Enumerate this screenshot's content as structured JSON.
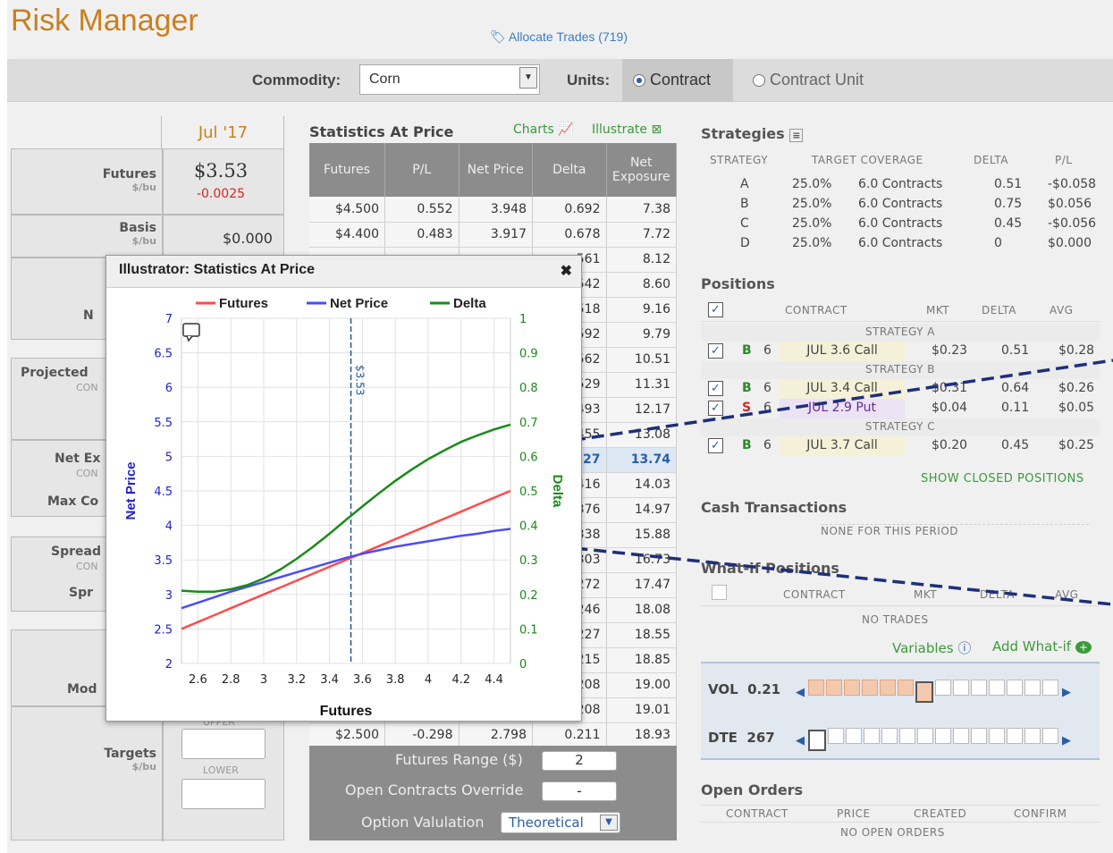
{
  "app": {
    "title": "Risk Manager",
    "allocate": "Allocate Trades (719)"
  },
  "toolbar": {
    "commodity_label": "Commodity:",
    "commodity_value": "Corn",
    "units_label": "Units:",
    "unit_contract": "Contract",
    "unit_contract_unit": "Contract Unit"
  },
  "left": {
    "month": "Jul '17",
    "futures_label": "Futures",
    "futures_unit": "$/bu",
    "futures_value": "$3.53",
    "futures_change": "-0.0025",
    "basis_label": "Basis",
    "basis_unit": "$/bu",
    "basis_value": "$0.000",
    "n_label": "N",
    "projected_label": "Projected",
    "projected_unit": "CON",
    "net_ex_label": "Net Ex",
    "net_ex_unit": "CON",
    "max_label": "Max Co",
    "spread_label": "Spread",
    "spread_unit": "CON",
    "spr_label": "Spr",
    "mod_label": "Mod",
    "upper_label": "UPPER",
    "targets_label": "Targets",
    "targets_unit": "$/bu",
    "lower_label": "LOWER"
  },
  "stats": {
    "title": "Statistics At Price",
    "charts": "Charts",
    "illustrate": "Illustrate",
    "headers": [
      "Futures",
      "P/L",
      "Net Price",
      "Delta",
      "Net Exposure"
    ],
    "rows": [
      [
        "$4.500",
        "0.552",
        "3.948",
        "0.692",
        "7.38"
      ],
      [
        "$4.400",
        "0.483",
        "3.917",
        "0.678",
        "7.72"
      ],
      [
        "",
        "",
        "",
        "561",
        "8.12"
      ],
      [
        "",
        "",
        "",
        "542",
        "8.60"
      ],
      [
        "",
        "",
        "",
        "518",
        "9.16"
      ],
      [
        "",
        "",
        "",
        "592",
        "9.79"
      ],
      [
        "",
        "",
        "",
        "562",
        "10.51"
      ],
      [
        "",
        "",
        "",
        "529",
        "11.31"
      ],
      [
        "",
        "",
        "",
        "493",
        "12.17"
      ],
      [
        "",
        "",
        "",
        "455",
        "13.08"
      ],
      [
        "",
        "",
        "",
        "27",
        "13.74"
      ],
      [
        "",
        "",
        "",
        "416",
        "14.03"
      ],
      [
        "",
        "",
        "",
        "376",
        "14.97"
      ],
      [
        "",
        "",
        "",
        "338",
        "15.88"
      ],
      [
        "",
        "",
        "",
        "303",
        "16.73"
      ],
      [
        "",
        "",
        "",
        "272",
        "17.47"
      ],
      [
        "",
        "",
        "",
        "246",
        "18.08"
      ],
      [
        "",
        "",
        "",
        "227",
        "18.55"
      ],
      [
        "",
        "",
        "",
        "215",
        "18.85"
      ],
      [
        "",
        "",
        "",
        "208",
        "19.00"
      ],
      [
        "",
        "",
        "",
        "208",
        "19.01"
      ],
      [
        "$2.500",
        "-0.298",
        "2.798",
        "0.211",
        "18.93"
      ]
    ],
    "range_label": "Futures Range ($)",
    "range_value": "2",
    "override_label": "Open Contracts Override",
    "override_value": "-",
    "valuation_label": "Option Valulation",
    "valuation_value": "Theoretical"
  },
  "strategies": {
    "title": "Strategies",
    "headers": [
      "STRATEGY",
      "TARGET COVERAGE",
      "DELTA",
      "P/L"
    ],
    "rows": [
      [
        "A",
        "25.0%",
        "6.0 Contracts",
        "0.51",
        "-$0.058"
      ],
      [
        "B",
        "25.0%",
        "6.0 Contracts",
        "0.75",
        "$0.056"
      ],
      [
        "C",
        "25.0%",
        "6.0 Contracts",
        "0.45",
        "-$0.056"
      ],
      [
        "D",
        "25.0%",
        "6.0 Contracts",
        "0",
        "$0.000"
      ]
    ]
  },
  "positions": {
    "title": "Positions",
    "headers": [
      "CONTRACT",
      "MKT",
      "DELTA",
      "AVG"
    ],
    "groups": [
      "STRATEGY A",
      "STRATEGY B",
      "STRATEGY C"
    ],
    "rows": [
      {
        "side": "B",
        "qty": "6",
        "contract": "JUL 3.6 Call",
        "mkt": "$0.23",
        "delta": "0.51",
        "avg": "$0.28"
      },
      {
        "side": "B",
        "qty": "6",
        "contract": "JUL 3.4 Call",
        "mkt": "$0.31",
        "delta": "0.64",
        "avg": "$0.26"
      },
      {
        "side": "S",
        "qty": "6",
        "contract": "JUL 2.9 Put",
        "mkt": "$0.04",
        "delta": "0.11",
        "avg": "$0.05"
      },
      {
        "side": "B",
        "qty": "6",
        "contract": "JUL 3.7 Call",
        "mkt": "$0.20",
        "delta": "0.45",
        "avg": "$0.25"
      }
    ],
    "show_closed": "SHOW CLOSED POSITIONS"
  },
  "cash": {
    "title": "Cash Transactions",
    "none": "NONE FOR THIS PERIOD"
  },
  "whatif": {
    "title": "What-if Positions",
    "headers": [
      "CONTRACT",
      "MKT",
      "DELTA",
      "AVG"
    ],
    "none": "NO TRADES",
    "variables": "Variables",
    "add": "Add What-if",
    "vol_label": "VOL",
    "vol_value": "0.21",
    "dte_label": "DTE",
    "dte_value": "267"
  },
  "orders": {
    "title": "Open Orders",
    "headers": [
      "CONTRACT",
      "PRICE",
      "CREATED",
      "CONFIRM"
    ],
    "none": "NO OPEN ORDERS"
  },
  "popup": {
    "title": "Illustrator: Statistics At Price",
    "close": "✖",
    "marker": "$3.53"
  },
  "colors": {
    "futures": "#ff4b4b",
    "net_price": "#4b4bff",
    "delta": "#1a8a1a"
  },
  "chart_data": {
    "type": "line",
    "title": "",
    "xlabel": "Futures",
    "ylabel": "Net Price",
    "y2label": "Delta",
    "xlim": [
      2.5,
      4.5
    ],
    "ylim": [
      2,
      7
    ],
    "y2lim": [
      0,
      1
    ],
    "xticks": [
      "2.6",
      "2.8",
      "3",
      "3.2",
      "3.4",
      "3.6",
      "3.8",
      "4",
      "4.2",
      "4.4"
    ],
    "yticks": [
      "2",
      "2.5",
      "3",
      "3.5",
      "4",
      "4.5",
      "5",
      "5.5",
      "6",
      "6.5",
      "7"
    ],
    "y2ticks": [
      "0",
      "0.1",
      "0.2",
      "0.3",
      "0.4",
      "0.5",
      "0.6",
      "0.7",
      "0.8",
      "0.9",
      "1"
    ],
    "marker_x": 3.53,
    "x": [
      2.5,
      2.6,
      2.7,
      2.8,
      2.9,
      3.0,
      3.1,
      3.2,
      3.3,
      3.4,
      3.5,
      3.6,
      3.7,
      3.8,
      3.9,
      4.0,
      4.1,
      4.2,
      4.3,
      4.4,
      4.5
    ],
    "series": [
      {
        "name": "Futures",
        "axis": "left",
        "values": [
          2.5,
          2.6,
          2.7,
          2.8,
          2.9,
          3.0,
          3.1,
          3.2,
          3.3,
          3.4,
          3.5,
          3.6,
          3.7,
          3.8,
          3.9,
          4.0,
          4.1,
          4.2,
          4.3,
          4.4,
          4.5
        ]
      },
      {
        "name": "Net Price",
        "axis": "left",
        "values": [
          2.8,
          2.88,
          2.96,
          3.04,
          3.11,
          3.18,
          3.25,
          3.32,
          3.39,
          3.46,
          3.53,
          3.59,
          3.64,
          3.69,
          3.73,
          3.77,
          3.81,
          3.85,
          3.88,
          3.92,
          3.95
        ]
      },
      {
        "name": "Delta",
        "axis": "right",
        "values": [
          0.211,
          0.208,
          0.208,
          0.215,
          0.227,
          0.246,
          0.272,
          0.303,
          0.338,
          0.376,
          0.416,
          0.455,
          0.493,
          0.529,
          0.562,
          0.592,
          0.618,
          0.642,
          0.661,
          0.678,
          0.692
        ]
      }
    ]
  }
}
